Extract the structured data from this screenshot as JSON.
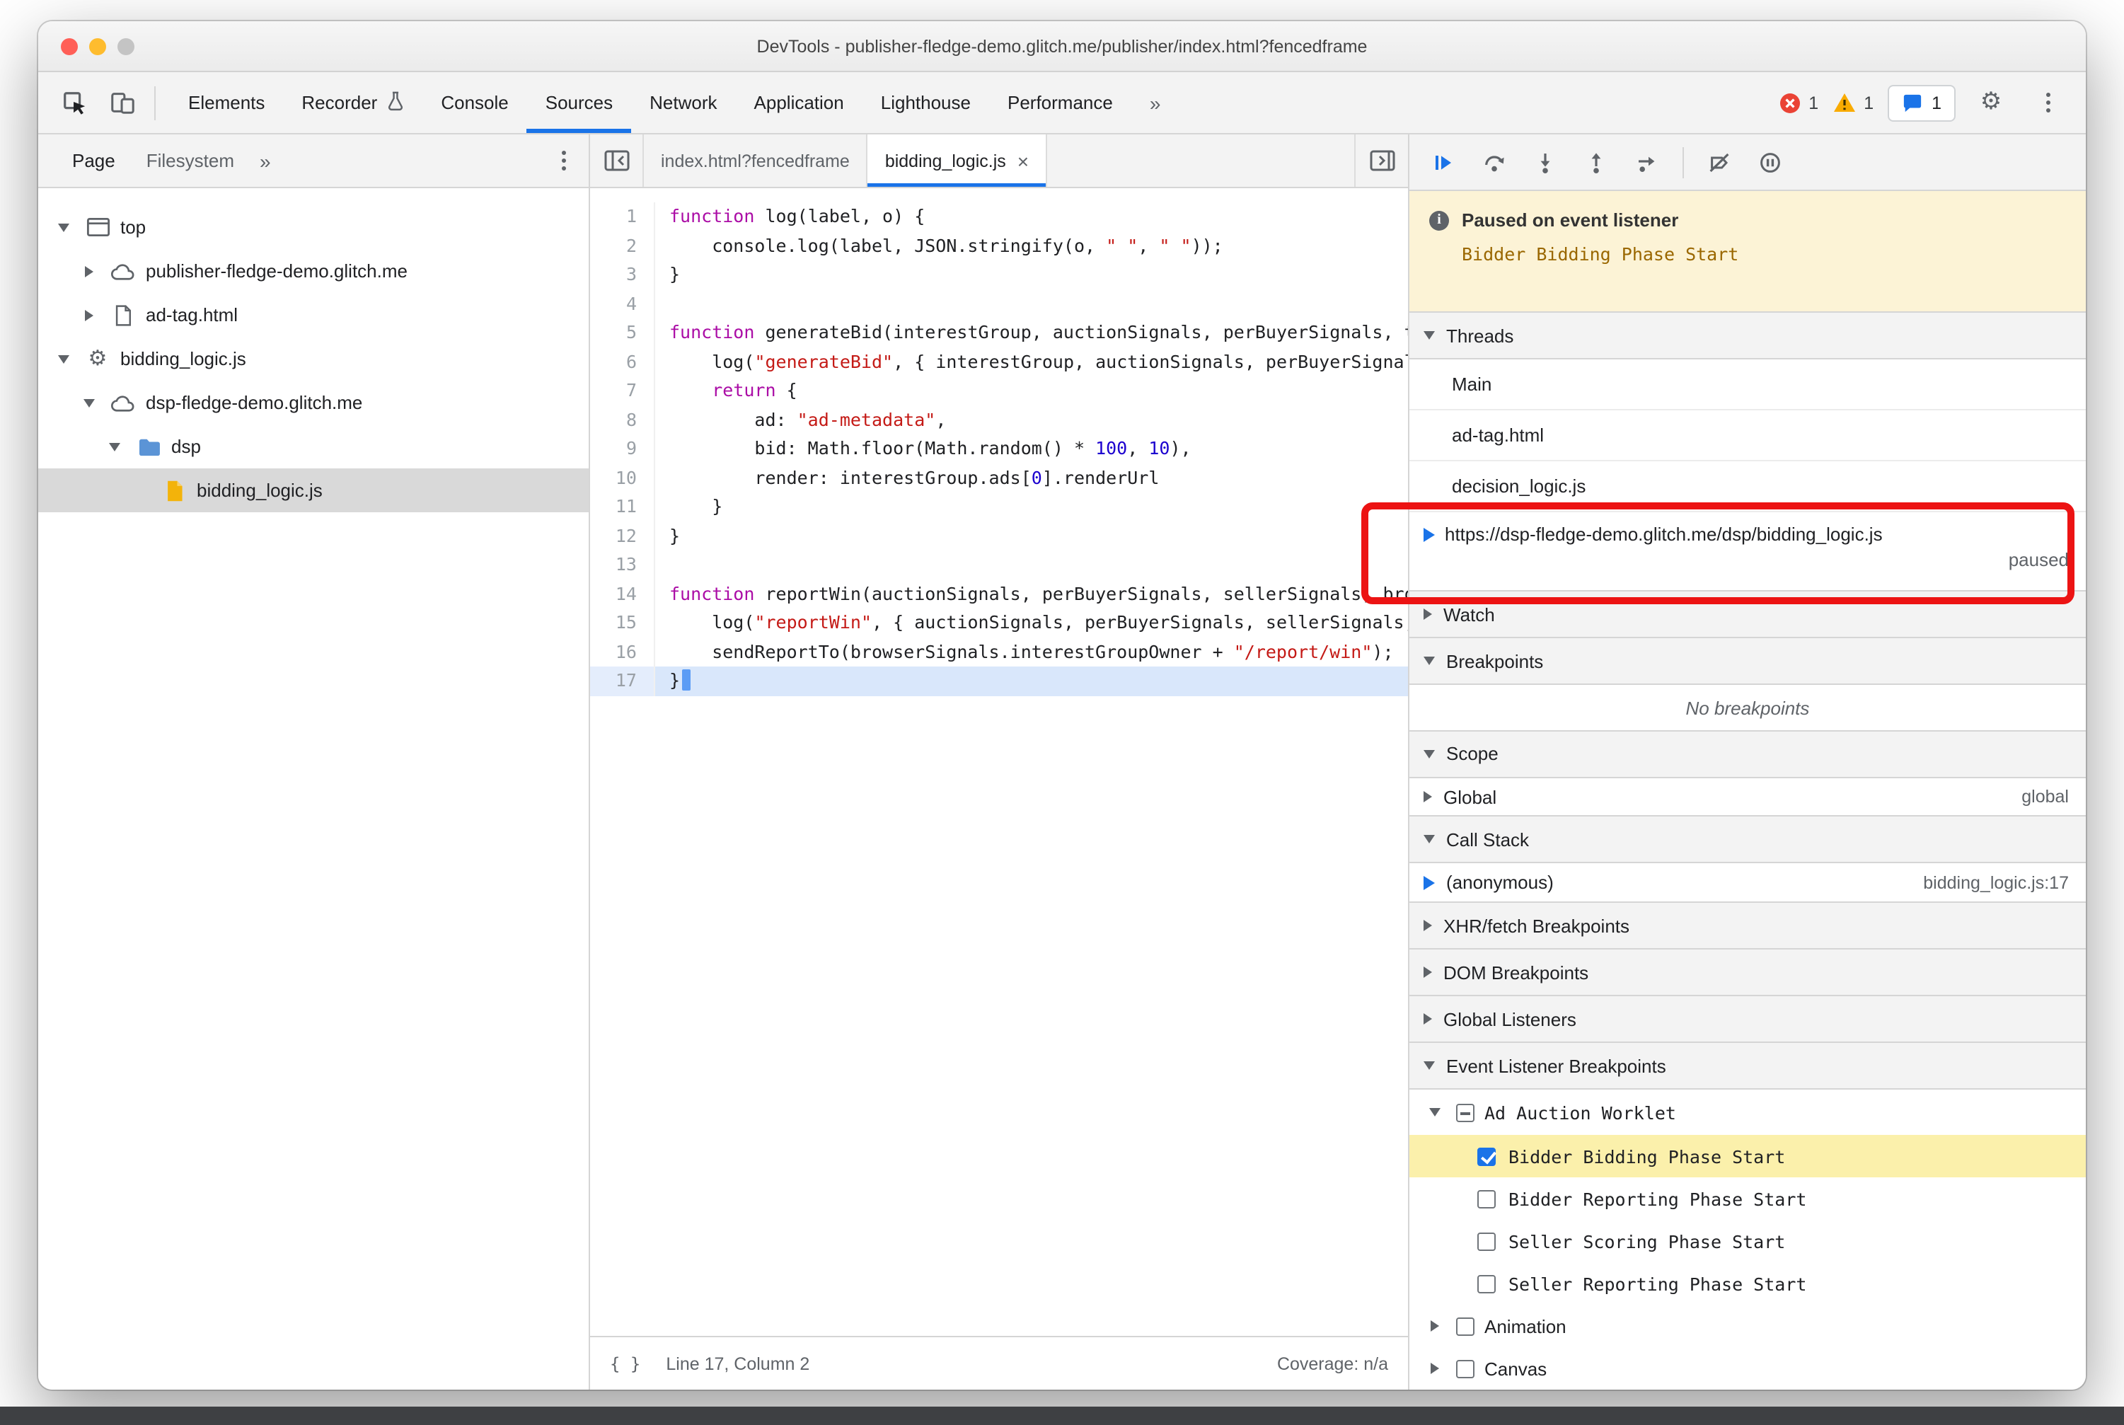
{
  "theme": {
    "accent": "#1a73e8",
    "annotation": "#ec1313",
    "banner": "#fcf3d6",
    "highlight": "#fbf0ab",
    "exec": "#d9e7fb",
    "selected_row": "#d9d9d9",
    "traffic_red": "#ff5f57",
    "traffic_yellow": "#febc2e",
    "traffic_gray": "#c4c4c4"
  },
  "window": {
    "title": "DevTools - publisher-fledge-demo.glitch.me/publisher/index.html?fencedframe"
  },
  "toolbar": {
    "tabs": [
      {
        "label": "Elements"
      },
      {
        "label": "Recorder",
        "icon": "flask"
      },
      {
        "label": "Console"
      },
      {
        "label": "Sources",
        "selected": true
      },
      {
        "label": "Network"
      },
      {
        "label": "Application"
      },
      {
        "label": "Lighthouse"
      },
      {
        "label": "Performance"
      },
      {
        "label": "»",
        "more": true
      }
    ],
    "errors": "1",
    "warnings": "1",
    "issues": "1"
  },
  "sidebar": {
    "tabs": [
      "Page",
      "Filesystem",
      "»"
    ],
    "tree": [
      {
        "label": "top",
        "icon": "frame",
        "arrow": "down",
        "indent": 0
      },
      {
        "label": "publisher-fledge-demo.glitch.me",
        "icon": "cloud",
        "arrow": "right",
        "indent": 1
      },
      {
        "label": "ad-tag.html",
        "icon": "doc",
        "arrow": "right",
        "indent": 1
      },
      {
        "label": "bidding_logic.js",
        "icon": "gear",
        "arrow": "down",
        "indent": 0
      },
      {
        "label": "dsp-fledge-demo.glitch.me",
        "icon": "cloud",
        "arrow": "down",
        "indent": 1
      },
      {
        "label": "dsp",
        "icon": "folder",
        "arrow": "down",
        "indent": 2
      },
      {
        "label": "bidding_logic.js",
        "icon": "jsfile",
        "arrow": "none",
        "indent": 3,
        "selected": true
      }
    ]
  },
  "editor": {
    "tabs": [
      {
        "label": "index.html?fencedframe"
      },
      {
        "label": "bidding_logic.js",
        "active": true
      }
    ],
    "execution_line": 17,
    "lines": [
      {
        "n": 1,
        "segs": [
          [
            "k",
            "function"
          ],
          [
            "p",
            " log(label, o) {"
          ]
        ]
      },
      {
        "n": 2,
        "segs": [
          [
            "p",
            "    console.log(label, JSON.stringify(o, "
          ],
          [
            "s",
            "\" \""
          ],
          [
            "p",
            ", "
          ],
          [
            "s",
            "\" \""
          ],
          [
            "p",
            "));"
          ]
        ]
      },
      {
        "n": 3,
        "segs": [
          [
            "p",
            "}"
          ]
        ]
      },
      {
        "n": 4,
        "segs": [
          [
            "p",
            ""
          ]
        ]
      },
      {
        "n": 5,
        "segs": [
          [
            "k",
            "function"
          ],
          [
            "p",
            " generateBid(interestGroup, auctionSignals, perBuyerSignals, trustedBiddingSignals, browserSignals) {"
          ]
        ]
      },
      {
        "n": 6,
        "segs": [
          [
            "p",
            "    log("
          ],
          [
            "s",
            "\"generateBid\""
          ],
          [
            "p",
            ", { interestGroup, auctionSignals, perBuyerSignals, trustedBiddingSignals, browserSignals });"
          ]
        ]
      },
      {
        "n": 7,
        "segs": [
          [
            "p",
            "    "
          ],
          [
            "k",
            "return"
          ],
          [
            "p",
            " {"
          ]
        ]
      },
      {
        "n": 8,
        "segs": [
          [
            "p",
            "        ad: "
          ],
          [
            "s",
            "\"ad-metadata\""
          ],
          [
            "p",
            ","
          ]
        ]
      },
      {
        "n": 9,
        "segs": [
          [
            "p",
            "        bid: Math.floor(Math.random() * "
          ],
          [
            "n2",
            "100"
          ],
          [
            "p",
            ", "
          ],
          [
            "n2",
            "10"
          ],
          [
            "p",
            "),"
          ]
        ]
      },
      {
        "n": 10,
        "segs": [
          [
            "p",
            "        render: interestGroup.ads["
          ],
          [
            "n2",
            "0"
          ],
          [
            "p",
            "].renderUrl"
          ]
        ]
      },
      {
        "n": 11,
        "segs": [
          [
            "p",
            "    }"
          ]
        ]
      },
      {
        "n": 12,
        "segs": [
          [
            "p",
            "}"
          ]
        ]
      },
      {
        "n": 13,
        "segs": [
          [
            "p",
            ""
          ]
        ]
      },
      {
        "n": 14,
        "segs": [
          [
            "k",
            "function"
          ],
          [
            "p",
            " reportWin(auctionSignals, perBuyerSignals, sellerSignals, browserSignals) {"
          ]
        ]
      },
      {
        "n": 15,
        "segs": [
          [
            "p",
            "    log("
          ],
          [
            "s",
            "\"reportWin\""
          ],
          [
            "p",
            ", { auctionSignals, perBuyerSignals, sellerSignals, browserSignals });"
          ]
        ]
      },
      {
        "n": 16,
        "segs": [
          [
            "p",
            "    sendReportTo(browserSignals.interestGroupOwner + "
          ],
          [
            "s",
            "\"/report/win\""
          ],
          [
            "p",
            ");"
          ]
        ]
      },
      {
        "n": 17,
        "segs": [
          [
            "p",
            "}"
          ]
        ]
      }
    ],
    "status": {
      "line_col": "Line 17, Column 2",
      "coverage": "Coverage: n/a"
    }
  },
  "debugger": {
    "paused": {
      "title": "Paused on event listener",
      "detail": "Bidder Bidding Phase Start"
    },
    "threads": {
      "title": "Threads",
      "items": [
        {
          "label": "Main"
        },
        {
          "label": "ad-tag.html"
        },
        {
          "label": "decision_logic.js"
        },
        {
          "label": "https://dsp-fledge-demo.glitch.me/dsp/bidding_logic.js",
          "current": true,
          "status": "paused"
        }
      ]
    },
    "watch_title": "Watch",
    "breakpoints_title": "Breakpoints",
    "breakpoints_empty": "No breakpoints",
    "scope_title": "Scope",
    "scope_global_label": "Global",
    "scope_global_value": "global",
    "callstack_title": "Call Stack",
    "callstack_frame": "(anonymous)",
    "callstack_location": "bidding_logic.js:17",
    "xhr_title": "XHR/fetch Breakpoints",
    "dom_title": "DOM Breakpoints",
    "global_listeners_title": "Global Listeners",
    "elb_title": "Event Listener Breakpoints",
    "elb": {
      "group": {
        "label": "Ad Auction Worklet",
        "state": "indeterminate",
        "expanded": true
      },
      "phases": [
        {
          "label": "Bidder Bidding Phase Start",
          "checked": true,
          "highlight": true
        },
        {
          "label": "Bidder Reporting Phase Start",
          "checked": false
        },
        {
          "label": "Seller Scoring Phase Start",
          "checked": false
        },
        {
          "label": "Seller Reporting Phase Start",
          "checked": false
        }
      ],
      "others": [
        {
          "label": "Animation",
          "checked": false
        },
        {
          "label": "Canvas",
          "checked": false
        }
      ]
    }
  }
}
